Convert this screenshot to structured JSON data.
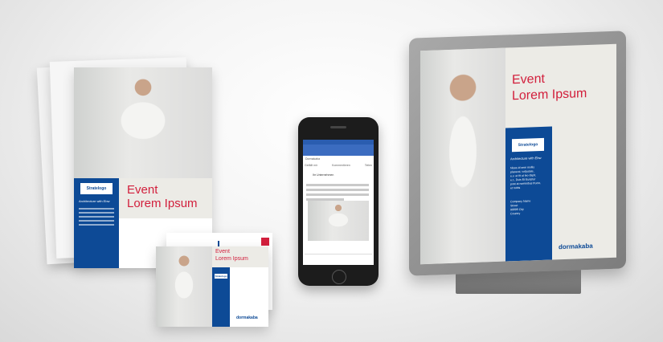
{
  "flyer": {
    "headline_line1": "Event",
    "headline_line2": "Lorem Ipsum",
    "logo_label": "Stratelogo",
    "sub_label": "Architecture with Ebw"
  },
  "postcard": {
    "headline_line1": "Event",
    "headline_line2": "Lorem Ipsum",
    "logo_label": "Stratelogo",
    "brand": "dormakaba"
  },
  "phone": {
    "page_title": "Dormakaba",
    "actions": [
      "Gefällt mir",
      "Kommentieren",
      "Teilen"
    ],
    "post_author": "Ihr Unternehmen"
  },
  "billboard": {
    "headline_line1": "Event",
    "headline_line2": "Lorem Ipsum",
    "logo_label": "Stratelogo",
    "sub_label": "Architecture with Ebw",
    "body_lines": [
      "Nisus id sem mollis",
      "placerat, volputate,",
      "e.v. et fit ut leo dapit,",
      "e.t., Duis Et Eunptur",
      "post at nominibus fructo,",
      "et nobis"
    ],
    "address_lines": [
      "Company Name",
      "Street",
      "99999 City",
      "Country"
    ],
    "brand": "dormakaba"
  }
}
